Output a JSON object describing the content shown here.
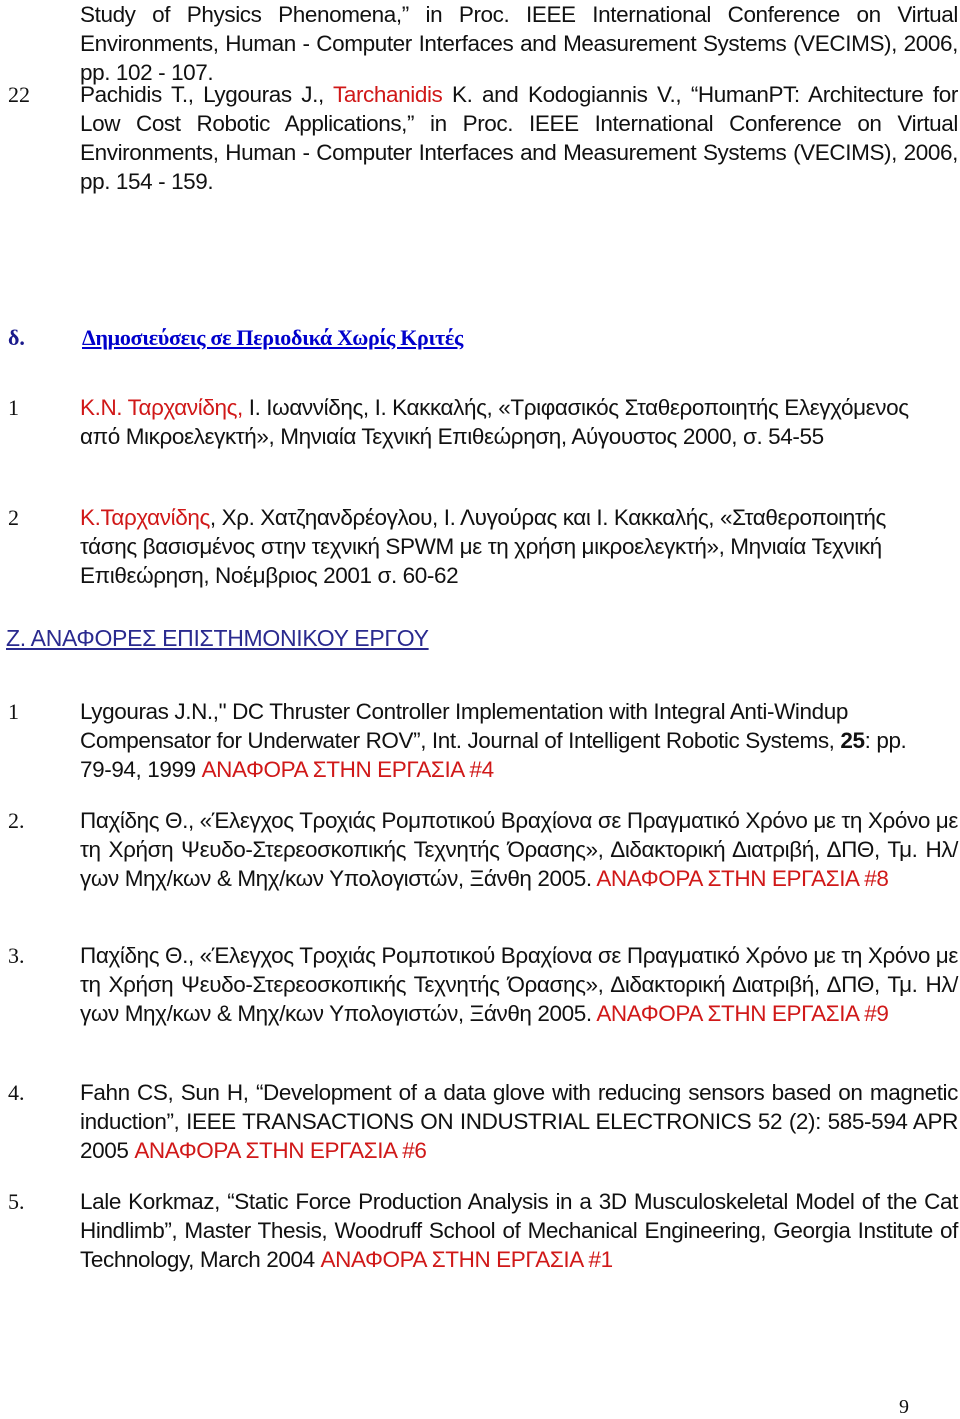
{
  "page": {
    "page_number": "9",
    "colors": {
      "text": "#111111",
      "highlight_red": "#d01818",
      "heading_navy": "#1a1a8c",
      "heading_link_blue": "#0000cc",
      "heading_section": "#2a2a8f"
    }
  },
  "continued_ref": {
    "text": "Study of Physics Phenomena,” in Proc. IEEE International Conference on Virtual Environments, Human - Computer Interfaces and Measurement Systems (VECIMS), 2006, pp. 102 - 107."
  },
  "ref22": {
    "number": "22",
    "pre": "Pachidis T., Lygouras J., ",
    "highlight": "Tarchanidis",
    "post": " K. and Kodogiannis V., “HumanPT: Architecture for Low Cost Robotic Applications,” in Proc. IEEE International Conference on Virtual Environments, Human - Computer Interfaces and Measurement Systems (VECIMS), 2006, pp. 154 - 159."
  },
  "section_d": {
    "label": "δ.",
    "title": "Δημοσιεύσεις σε Περιοδικά Χωρίς Κριτές",
    "items": [
      {
        "number": "1",
        "highlight": "Κ.Ν. Ταρχανίδης,",
        "post": " Ι. Ιωαννίδης, Ι. Κακκαλής, «Τριφασικός Σταθεροποιητής Ελεγχόμενος από Μικροελεγκτή», Μηνιαία Τεχνική Επιθεώρηση, Αύγουστος 2000, σ. 54-55"
      },
      {
        "number": "2",
        "highlight": "Κ.Ταρχανίδης",
        "post": ", Χρ. Χατζηανδρέογλου, Ι. Λυγούρας και Ι. Κακκαλής, «Σταθεροποιητής τάσης βασισμένος στην τεχνική SPWM με τη χρήση μικροελεγκτή», Μηνιαία Τεχνική Επιθεώρηση, Νοέμβριος 2001 σ. 60-62"
      }
    ]
  },
  "section_z": {
    "title": "Ζ. ΑΝΑΦΟΡΕΣ ΕΠΙΣΤΗΜΟΝΙΚΟΥ ΕΡΓΟΥ",
    "items": [
      {
        "number": "1",
        "pre": "Lygouras J.N.,\" DC Thruster Controller Implementation with Integral Anti-Windup Compensator for Underwater ROV”, Int. Journal of Intelligent Robotic Systems, ",
        "bold": "25",
        "post": ": pp. 79-94, 1999 ",
        "cite": "ΑΝΑΦΟΡΑ ΣΤΗΝ ΕΡΓΑΣΙΑ #4"
      },
      {
        "number": "2.",
        "pre": "Παχίδης Θ., «Έλεγχος Τροχιάς Ρομποτικού Βραχίονα σε Πραγματικό Χρόνο με τη Χρόνο με τη Χρήση Ψευδο-Στερεοσκοπικής Τεχνητής Όρασης», Διδακτορική Διατριβή, ΔΠΘ, Τμ. Ηλ/γων Μηχ/κων & Μηχ/κων Υπολογιστών, Ξάνθη 2005. ",
        "cite": "ΑΝΑΦΟΡΑ ΣΤΗΝ ΕΡΓΑΣΙΑ #8"
      },
      {
        "number": "3.",
        "pre": "Παχίδης Θ., «Έλεγχος Τροχιάς Ρομποτικού Βραχίονα σε Πραγματικό Χρόνο με τη Χρόνο με τη Χρήση Ψευδο-Στερεοσκοπικής Τεχνητής Όρασης», Διδακτορική Διατριβή, ΔΠΘ, Τμ. Ηλ/γων Μηχ/κων & Μηχ/κων Υπολογιστών, Ξάνθη 2005. ",
        "cite": "ΑΝΑΦΟΡΑ ΣΤΗΝ ΕΡΓΑΣΙΑ #9"
      },
      {
        "number": "4.",
        "pre": "Fahn CS, Sun H, “Development of a data glove with reducing sensors based on magnetic induction”, IEEE TRANSACTIONS ON INDUSTRIAL ELECTRONICS 52 (2): 585-594 APR 2005 ",
        "cite": "ΑΝΑΦΟΡΑ ΣΤΗΝ ΕΡΓΑΣΙΑ #6"
      },
      {
        "number": "5.",
        "pre": "Lale Korkmaz, “Static Force Production Analysis in a 3D Musculoskeletal Model of the Cat Hindlimb”, Master Thesis, Woodruff School of Mechanical Engineering, Georgia Institute of Technology, March 2004 ",
        "cite": "ΑΝΑΦΟΡΑ ΣΤΗΝ ΕΡΓΑΣΙΑ #1"
      }
    ]
  }
}
